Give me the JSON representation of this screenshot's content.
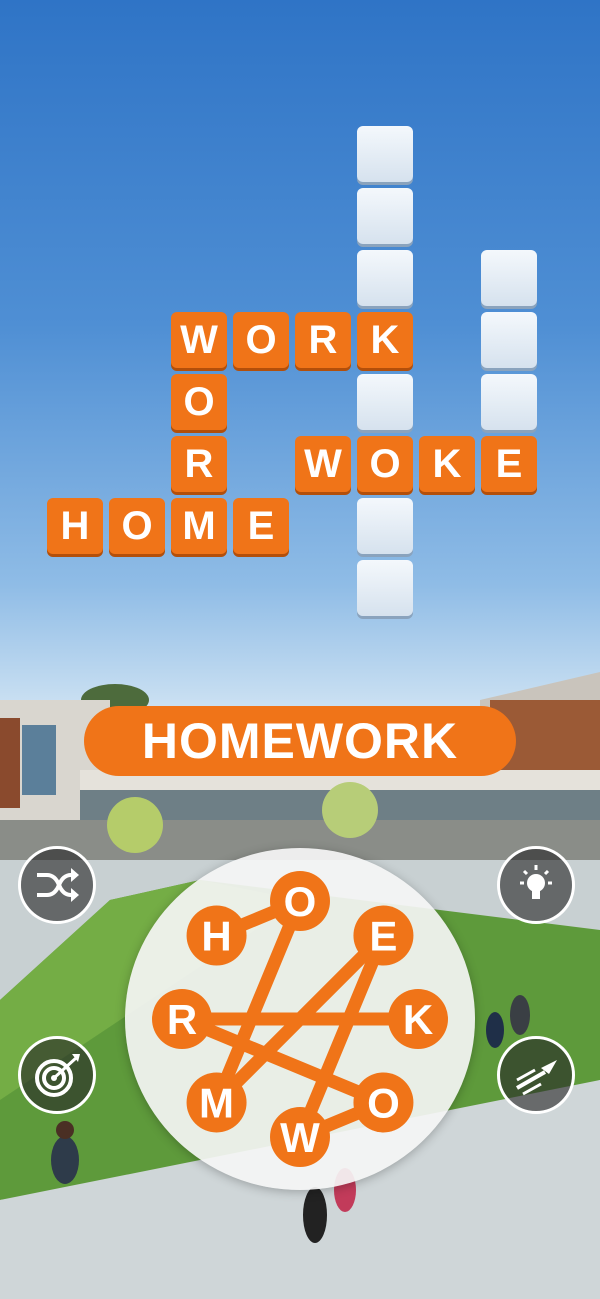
{
  "grid": {
    "letters": [
      {
        "row": 0,
        "col": 2,
        "char": "W"
      },
      {
        "row": 0,
        "col": 3,
        "char": "O"
      },
      {
        "row": 0,
        "col": 4,
        "char": "R"
      },
      {
        "row": 0,
        "col": 5,
        "char": "K"
      },
      {
        "row": 1,
        "col": 2,
        "char": "O"
      },
      {
        "row": 2,
        "col": 2,
        "char": "R"
      },
      {
        "row": 2,
        "col": 4,
        "char": "W"
      },
      {
        "row": 2,
        "col": 5,
        "char": "O"
      },
      {
        "row": 2,
        "col": 6,
        "char": "K"
      },
      {
        "row": 2,
        "col": 7,
        "char": "E"
      },
      {
        "row": 3,
        "col": 0,
        "char": "H"
      },
      {
        "row": 3,
        "col": 1,
        "char": "O"
      },
      {
        "row": 3,
        "col": 2,
        "char": "M"
      },
      {
        "row": 3,
        "col": 3,
        "char": "E"
      }
    ],
    "empty": [
      {
        "row": -3,
        "col": 5
      },
      {
        "row": -2,
        "col": 5
      },
      {
        "row": -1,
        "col": 5
      },
      {
        "row": -1,
        "col": 7
      },
      {
        "row": 0,
        "col": 7
      },
      {
        "row": 1,
        "col": 7
      },
      {
        "row": 1,
        "col": 5
      },
      {
        "row": 3,
        "col": 5
      },
      {
        "row": 4,
        "col": 5
      }
    ]
  },
  "current_word": "HOMEWORK",
  "wheel_letters": [
    "O",
    "E",
    "K",
    "O",
    "W",
    "M",
    "R",
    "H"
  ],
  "controls": {
    "shuffle": "shuffle-icon",
    "hint": "lightbulb-icon",
    "target": "target-icon",
    "rocket": "rocket-icon"
  },
  "colors": {
    "accent": "#f07418",
    "empty_tile": "#e6eef6"
  }
}
